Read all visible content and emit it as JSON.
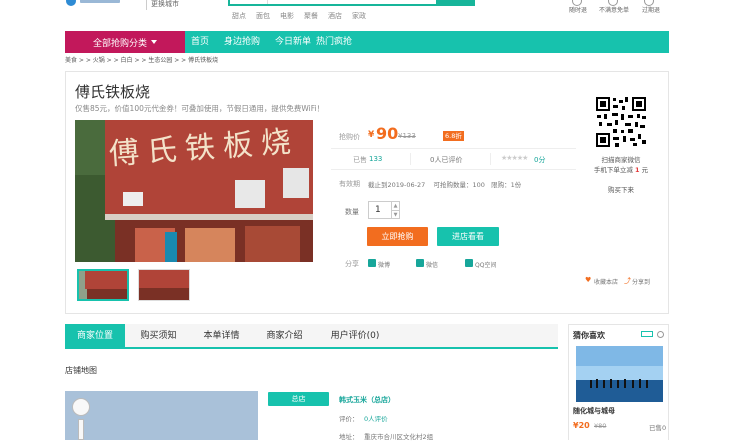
{
  "header": {
    "city_switch": "更换城市",
    "hot_words": [
      "甜点",
      "面包",
      "电影",
      "聚餐",
      "酒店",
      "家政"
    ],
    "right_links": [
      "随时退",
      "不满意免单",
      "过期退"
    ]
  },
  "nav": {
    "all_categories": "全部抢购分类",
    "items": [
      "首页",
      "身边抢购",
      "今日新单",
      "热门疯抢"
    ]
  },
  "breadcrumb": "美食 > > 火锅 > > 白白 > > 生态公园 > > 傅氏铁板烧",
  "deal": {
    "title": "傅氏铁板烧",
    "subtitle": "仅售85元，价值100元代金券！可叠加使用，节假日通用，提供免费WiFi！",
    "shop_sign_text": "傅氏铁板烧",
    "price_label": "抢购价",
    "price_currency": "¥",
    "price": "90",
    "original_price": "¥133",
    "discount_badge": "6.8折",
    "sold_label": "已售",
    "sold_count": "133",
    "review_summary": "0人已评价",
    "rating": 0,
    "rating_text": "0分",
    "validity_label": "有效期",
    "validity_text": "截止到2019-06-27    可抢购数量：100   限购：1份",
    "qty_label": "数量",
    "qty_value": "1",
    "buy_button": "立即抢购",
    "cart_button": "进店看看",
    "share_label": "分享",
    "share_items": [
      "微博",
      "微信",
      "QQ空间"
    ],
    "qr_caption": "扫描商家微信",
    "qr_caption2_prefix": "手机下单立减",
    "qr_discount": "1",
    "qr_caption2_suffix": "元",
    "qr_link": "购买下来",
    "favorite": "收藏本店",
    "share_link": "分享到"
  },
  "tabs": [
    "商家位置",
    "购买须知",
    "本单详情",
    "商家介绍",
    "用户评价(0)"
  ],
  "store_map": {
    "title": "店铺地图",
    "badge": "总店",
    "name": "韩式玉米（总店）",
    "reviews_label": "评价：",
    "reviews_value": "0人评价",
    "address_label": "地址：",
    "address_value": "重庆市合川区文化村2组"
  },
  "sidebar": {
    "title": "猜你喜欢",
    "product_name": "随化城与城母",
    "price": "¥20",
    "original_price": "¥80",
    "sold": "已售0"
  }
}
